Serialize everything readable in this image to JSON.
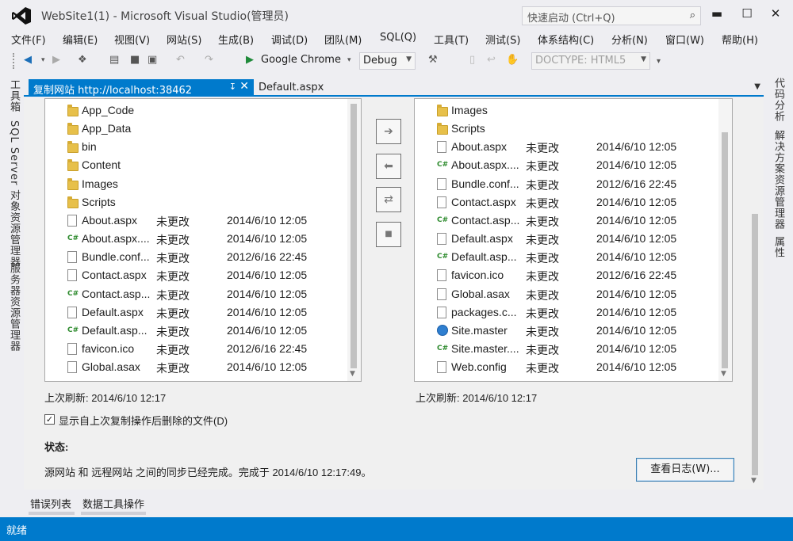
{
  "window": {
    "title": "WebSite1(1) - Microsoft Visual Studio(管理员)",
    "quick_launch_placeholder": "快速启动 (Ctrl+Q)",
    "min": "▬",
    "max": "☐",
    "close": "✕"
  },
  "menu": [
    "文件(F)",
    "编辑(E)",
    "视图(V)",
    "网站(S)",
    "生成(B)",
    "调试(D)",
    "团队(M)",
    "SQL(Q)",
    "工具(T)",
    "测试(S)",
    "体系结构(C)",
    "分析(N)",
    "窗口(W)",
    "帮助(H)"
  ],
  "toolbar": {
    "browser": "Google Chrome",
    "config": "Debug",
    "doctype": "DOCTYPE: HTML5"
  },
  "left_strip": [
    "工具箱",
    "SQL Server 对象资源管理器",
    "服务器资源管理器"
  ],
  "right_strip": [
    "代码分析",
    "解决方案资源管理器",
    "属性"
  ],
  "tabs": {
    "active": "复制网站 http://localhost:38462",
    "second": "Default.aspx"
  },
  "left_files": [
    {
      "type": "folder",
      "name": "App_Code",
      "status": "",
      "date": ""
    },
    {
      "type": "folder",
      "name": "App_Data",
      "status": "",
      "date": ""
    },
    {
      "type": "folder",
      "name": "bin",
      "status": "",
      "date": ""
    },
    {
      "type": "folder",
      "name": "Content",
      "status": "",
      "date": ""
    },
    {
      "type": "folder",
      "name": "Images",
      "status": "",
      "date": ""
    },
    {
      "type": "folder",
      "name": "Scripts",
      "status": "",
      "date": ""
    },
    {
      "type": "file",
      "name": "About.aspx",
      "status": "未更改",
      "date": "2014/6/10 12:05"
    },
    {
      "type": "cs",
      "name": "About.aspx....",
      "status": "未更改",
      "date": "2014/6/10 12:05"
    },
    {
      "type": "file",
      "name": "Bundle.conf...",
      "status": "未更改",
      "date": "2012/6/16 22:45"
    },
    {
      "type": "file",
      "name": "Contact.aspx",
      "status": "未更改",
      "date": "2014/6/10 12:05"
    },
    {
      "type": "cs",
      "name": "Contact.asp...",
      "status": "未更改",
      "date": "2014/6/10 12:05"
    },
    {
      "type": "file",
      "name": "Default.aspx",
      "status": "未更改",
      "date": "2014/6/10 12:05"
    },
    {
      "type": "cs",
      "name": "Default.asp...",
      "status": "未更改",
      "date": "2014/6/10 12:05"
    },
    {
      "type": "file",
      "name": "favicon.ico",
      "status": "未更改",
      "date": "2012/6/16 22:45"
    },
    {
      "type": "file",
      "name": "Global.asax",
      "status": "未更改",
      "date": "2014/6/10 12:05"
    }
  ],
  "right_files": [
    {
      "type": "folder",
      "name": "Images",
      "status": "",
      "date": ""
    },
    {
      "type": "folder",
      "name": "Scripts",
      "status": "",
      "date": ""
    },
    {
      "type": "file",
      "name": "About.aspx",
      "status": "未更改",
      "date": "2014/6/10 12:05"
    },
    {
      "type": "cs",
      "name": "About.aspx....",
      "status": "未更改",
      "date": "2014/6/10 12:05"
    },
    {
      "type": "file",
      "name": "Bundle.conf...",
      "status": "未更改",
      "date": "2012/6/16 22:45"
    },
    {
      "type": "file",
      "name": "Contact.aspx",
      "status": "未更改",
      "date": "2014/6/10 12:05"
    },
    {
      "type": "cs",
      "name": "Contact.asp...",
      "status": "未更改",
      "date": "2014/6/10 12:05"
    },
    {
      "type": "file",
      "name": "Default.aspx",
      "status": "未更改",
      "date": "2014/6/10 12:05"
    },
    {
      "type": "cs",
      "name": "Default.asp...",
      "status": "未更改",
      "date": "2014/6/10 12:05"
    },
    {
      "type": "file",
      "name": "favicon.ico",
      "status": "未更改",
      "date": "2012/6/16 22:45"
    },
    {
      "type": "file",
      "name": "Global.asax",
      "status": "未更改",
      "date": "2014/6/10 12:05"
    },
    {
      "type": "file",
      "name": "packages.c...",
      "status": "未更改",
      "date": "2014/6/10 12:05"
    },
    {
      "type": "globe",
      "name": "Site.master",
      "status": "未更改",
      "date": "2014/6/10 12:05"
    },
    {
      "type": "cs",
      "name": "Site.master....",
      "status": "未更改",
      "date": "2014/6/10 12:05"
    },
    {
      "type": "file",
      "name": "Web.config",
      "status": "未更改",
      "date": "2014/6/10 12:05"
    }
  ],
  "middle_buttons": [
    "➔",
    "⬅",
    "⇄",
    "■"
  ],
  "left_refresh": "上次刷新: 2014/6/10 12:17",
  "right_refresh": "上次刷新: 2014/6/10 12:17",
  "checkbox_label": "显示自上次复制操作后删除的文件(D)",
  "checkbox_checked": "✓",
  "status_heading": "状态:",
  "status_message": "源网站 和 远程网站 之间的同步已经完成。完成于 2014/6/10 12:17:49。",
  "log_button": "查看日志(W)...",
  "bottom_tabs": [
    "错误列表",
    "数据工具操作"
  ],
  "status_bar": "就绪",
  "colors": {
    "accent": "#007acc"
  }
}
